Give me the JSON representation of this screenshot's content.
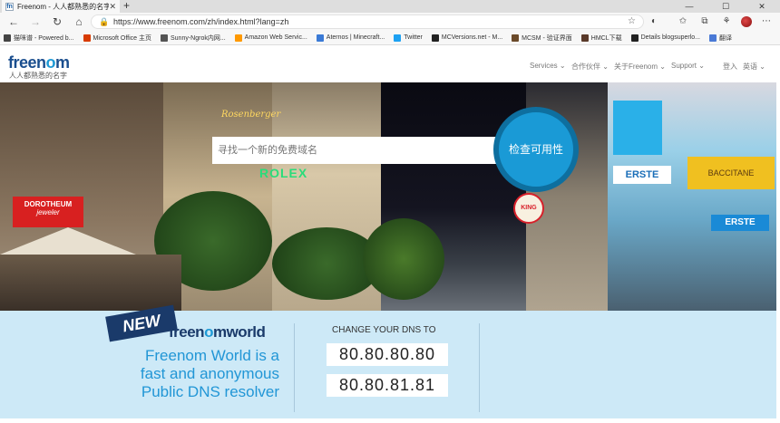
{
  "browser": {
    "tab_title": "Freenom - 人人都熟悉的名字",
    "new_tab_glyph": "+",
    "url": "https://www.freenom.com/zh/index.html?lang=zh",
    "bookmarks": [
      {
        "label": "猫咪谱 - Powered b...",
        "color": "#444444"
      },
      {
        "label": "Microsoft Office 主页",
        "color": "#d83b01"
      },
      {
        "label": "Sunny-Ngrok内网...",
        "color": "#555555"
      },
      {
        "label": "Amazon Web Servic...",
        "color": "#ff9900"
      },
      {
        "label": "Aternos | Minecraft...",
        "color": "#3a7ad6"
      },
      {
        "label": "Twitter",
        "color": "#1da1f2"
      },
      {
        "label": "MCVersions.net - M...",
        "color": "#222222"
      },
      {
        "label": "MCSM - 验证界面",
        "color": "#6b4a2a"
      },
      {
        "label": "HMCL下载",
        "color": "#5a3a2a"
      },
      {
        "label": "Details blogsuperlo...",
        "color": "#222222"
      },
      {
        "label": "翻译",
        "color": "#4a7ad6"
      }
    ]
  },
  "site": {
    "logo_a": "freen",
    "logo_b": "o",
    "logo_c": "m",
    "tagline": "人人都熟悉的名字",
    "nav": [
      {
        "label": "Services ⌄"
      },
      {
        "label": "合作伙伴 ⌄"
      },
      {
        "label": "关于Freenom ⌄"
      },
      {
        "label": "Support ⌄"
      },
      {
        "label": "登入"
      },
      {
        "label": "英语 ⌄"
      }
    ]
  },
  "hero": {
    "search_placeholder": "寻找一个新的免费域名",
    "check_button": "检查可用性",
    "signs": [
      "Rosenberger",
      "ROLEX",
      "DOROTHEUM",
      "jeweler",
      "ERSTE",
      "ERSTE",
      "BACCITANE",
      "KING"
    ]
  },
  "promo": {
    "badge": "NEW",
    "logo_a": "freen",
    "logo_b": "o",
    "logo_c": "mworld",
    "lines": [
      "Freenom World is a",
      "fast and anonymous",
      "Public DNS resolver"
    ],
    "dns_title": "CHANGE YOUR DNS TO",
    "dns": [
      "80.80.80.80",
      "80.80.81.81"
    ]
  },
  "colors": {
    "brand_dark": "#1a4e8e",
    "brand_light": "#1e9ad6",
    "promo_bg": "#cde9f7"
  }
}
